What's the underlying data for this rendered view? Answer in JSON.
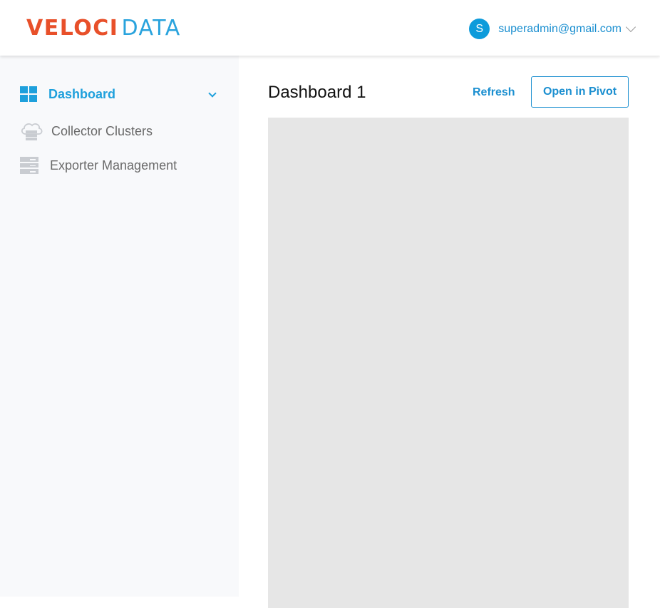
{
  "header": {
    "logo": {
      "part1": "VELOCI",
      "part2": "DATA"
    },
    "user": {
      "avatar_letter": "S",
      "email": "superadmin@gmail.com"
    }
  },
  "sidebar": {
    "items": [
      {
        "label": "Dashboard",
        "icon": "dashboard-grid-icon",
        "active": true
      },
      {
        "label": "Collector Clusters",
        "icon": "cloud-server-icon",
        "active": false
      },
      {
        "label": "Exporter Management",
        "icon": "server-rack-icon",
        "active": false
      }
    ]
  },
  "main": {
    "title": "Dashboard 1",
    "refresh_label": "Refresh",
    "open_pivot_label": "Open in Pivot"
  },
  "colors": {
    "brand_orange": "#e8502a",
    "brand_blue": "#29a3dd",
    "accent": "#1b8fd0",
    "sidebar_bg": "#f8f9fb",
    "panel_bg": "#e6e6e6"
  }
}
